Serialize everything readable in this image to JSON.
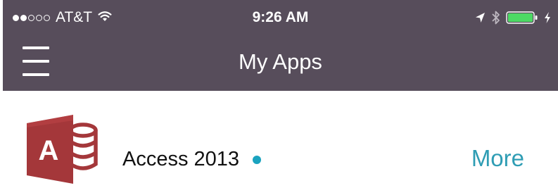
{
  "status_bar": {
    "carrier": "AT&T",
    "time": "9:26 AM",
    "icons": [
      "signal-dots-icon",
      "wifi-icon",
      "location-arrow-icon",
      "bluetooth-icon",
      "battery-icon",
      "charging-bolt-icon"
    ],
    "signal_strength": {
      "filled": 2,
      "total": 5
    },
    "battery_level": 1.0,
    "battery_color": "#4cd964"
  },
  "nav": {
    "title": "My Apps",
    "menu_icon": "hamburger-menu-icon",
    "background_color": "#574d5b"
  },
  "apps": [
    {
      "name": "Access 2013",
      "icon": "access-app-icon",
      "icon_letter": "A",
      "new_indicator": true,
      "action_label": "More",
      "accent_color": "#2f9db4",
      "brand_color": "#a4373a"
    }
  ]
}
